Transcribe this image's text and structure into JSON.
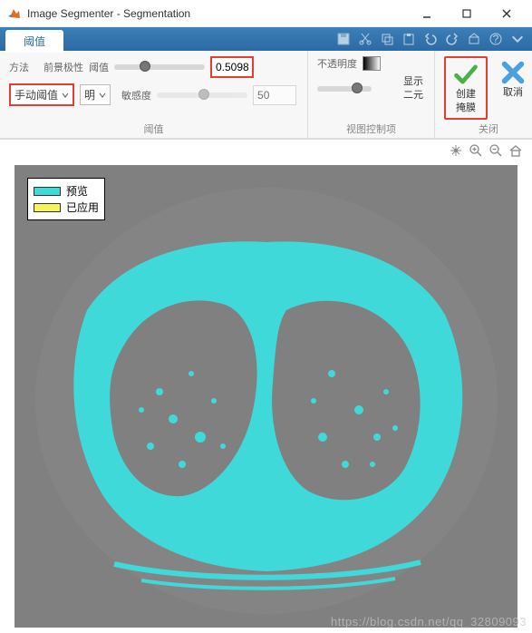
{
  "window": {
    "title": "Image Segmenter - Segmentation"
  },
  "tab": {
    "label": "阈值"
  },
  "threshold_group": {
    "method_label": "方法",
    "foreground_label": "前景极性",
    "threshold_label": "阈值",
    "threshold_value": "0.5098",
    "method_dropdown": "手动阈值",
    "polarity_dropdown": "明",
    "sensitivity_label": "敏感度",
    "sensitivity_value": "50",
    "group_name": "阈值"
  },
  "view_group": {
    "opacity_label": "不透明度",
    "show_binary_label_top": "显示",
    "show_binary_label_bot": "二元",
    "group_name": "视图控制项"
  },
  "close_group": {
    "create_mask_top": "创建",
    "create_mask_bot": "掩膜",
    "cancel_label": "取消",
    "group_name": "关闭"
  },
  "legend": {
    "preview": "预览",
    "applied": "已应用",
    "preview_color": "#3fd9d9",
    "applied_color": "#f5f55a"
  },
  "watermark": "https://blog.csdn.net/qq_32809093",
  "colors": {
    "highlight": "#e04030",
    "seg": "#3fd9d9",
    "canvas": "#808080"
  }
}
